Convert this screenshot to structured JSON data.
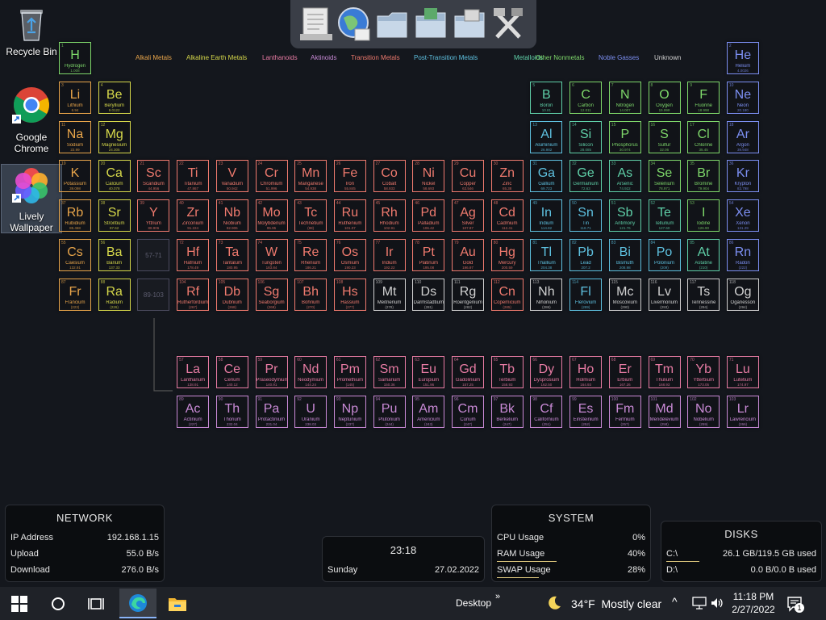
{
  "desktop": {
    "icons": [
      {
        "label1": "Recycle Bin",
        "label2": ""
      },
      {
        "label1": "Google",
        "label2": "Chrome"
      },
      {
        "label1": "Lively",
        "label2": "Wallpaper"
      }
    ]
  },
  "legend": [
    {
      "label": "Alkali Metals",
      "color": "#e8a54a"
    },
    {
      "label": "Alkaline Earth Metals",
      "color": "#d6d84a"
    },
    {
      "label": "Lanthanoids",
      "color": "#e77ba3"
    },
    {
      "label": "Aktinoids",
      "color": "#c98ad6"
    },
    {
      "label": "Transition Metals",
      "color": "#ef7a6e"
    },
    {
      "label": "Post-Transition Metals",
      "color": "#5ec1e0"
    },
    {
      "label": "Metalloids",
      "color": "#5fd0a8"
    },
    {
      "label": "Other Nonmetals",
      "color": "#7ed86a"
    },
    {
      "label": "Noble Gasses",
      "color": "#7c8ff2"
    },
    {
      "label": "Unknown",
      "color": "#d0d0d0"
    }
  ],
  "placeholders": [
    "57-71",
    "89-103"
  ],
  "elements": [
    [
      "H",
      "Hydrogen",
      "1.008",
      1,
      1,
      1,
      "nonmetal"
    ],
    [
      "He",
      "Helium",
      "4.0026",
      2,
      1,
      18,
      "noble"
    ],
    [
      "Li",
      "Lithium",
      "6.94",
      3,
      2,
      1,
      "alkali"
    ],
    [
      "Be",
      "Beryllium",
      "9.0122",
      4,
      2,
      2,
      "alkaline"
    ],
    [
      "B",
      "Boron",
      "10.81",
      5,
      2,
      13,
      "metalloid"
    ],
    [
      "C",
      "Carbon",
      "12.011",
      6,
      2,
      14,
      "nonmetal"
    ],
    [
      "N",
      "Nitrogen",
      "14.007",
      7,
      2,
      15,
      "nonmetal"
    ],
    [
      "O",
      "Oxygen",
      "15.999",
      8,
      2,
      16,
      "nonmetal"
    ],
    [
      "F",
      "Fluorine",
      "18.998",
      9,
      2,
      17,
      "nonmetal"
    ],
    [
      "Ne",
      "Neon",
      "20.180",
      10,
      2,
      18,
      "noble"
    ],
    [
      "Na",
      "Sodium",
      "22.99",
      11,
      3,
      1,
      "alkali"
    ],
    [
      "Mg",
      "Magnesium",
      "24.305",
      12,
      3,
      2,
      "alkaline"
    ],
    [
      "Al",
      "Aluminium",
      "26.982",
      13,
      3,
      13,
      "post"
    ],
    [
      "Si",
      "Silicon",
      "28.085",
      14,
      3,
      14,
      "metalloid"
    ],
    [
      "P",
      "Phosphorus",
      "30.974",
      15,
      3,
      15,
      "nonmetal"
    ],
    [
      "S",
      "Sulfur",
      "32.06",
      16,
      3,
      16,
      "nonmetal"
    ],
    [
      "Cl",
      "Chlorine",
      "35.45",
      17,
      3,
      17,
      "nonmetal"
    ],
    [
      "Ar",
      "Argon",
      "39.948",
      18,
      3,
      18,
      "noble"
    ],
    [
      "K",
      "Potassium",
      "39.098",
      19,
      4,
      1,
      "alkali"
    ],
    [
      "Ca",
      "Calcium",
      "40.078",
      20,
      4,
      2,
      "alkaline"
    ],
    [
      "Sc",
      "Scandium",
      "44.956",
      21,
      4,
      3,
      "transition"
    ],
    [
      "Ti",
      "Titanium",
      "47.867",
      22,
      4,
      4,
      "transition"
    ],
    [
      "V",
      "Vanadium",
      "50.942",
      23,
      4,
      5,
      "transition"
    ],
    [
      "Cr",
      "Chromium",
      "51.996",
      24,
      4,
      6,
      "transition"
    ],
    [
      "Mn",
      "Manganese",
      "54.938",
      25,
      4,
      7,
      "transition"
    ],
    [
      "Fe",
      "Iron",
      "55.845",
      26,
      4,
      8,
      "transition"
    ],
    [
      "Co",
      "Cobalt",
      "58.933",
      27,
      4,
      9,
      "transition"
    ],
    [
      "Ni",
      "Nickel",
      "58.693",
      28,
      4,
      10,
      "transition"
    ],
    [
      "Cu",
      "Copper",
      "63.546",
      29,
      4,
      11,
      "transition"
    ],
    [
      "Zn",
      "Zinc",
      "65.38",
      30,
      4,
      12,
      "transition"
    ],
    [
      "Ga",
      "Gallium",
      "69.723",
      31,
      4,
      13,
      "post"
    ],
    [
      "Ge",
      "Germanium",
      "72.63",
      32,
      4,
      14,
      "metalloid"
    ],
    [
      "As",
      "Arsenic",
      "74.922",
      33,
      4,
      15,
      "metalloid"
    ],
    [
      "Se",
      "Selenium",
      "78.971",
      34,
      4,
      16,
      "nonmetal"
    ],
    [
      "Br",
      "Bromine",
      "79.904",
      35,
      4,
      17,
      "nonmetal"
    ],
    [
      "Kr",
      "Krypton",
      "83.798",
      36,
      4,
      18,
      "noble"
    ],
    [
      "Rb",
      "Rubidium",
      "85.468",
      37,
      5,
      1,
      "alkali"
    ],
    [
      "Sr",
      "Strontium",
      "87.62",
      38,
      5,
      2,
      "alkaline"
    ],
    [
      "Y",
      "Yttrium",
      "88.906",
      39,
      5,
      3,
      "transition"
    ],
    [
      "Zr",
      "Zirconium",
      "91.224",
      40,
      5,
      4,
      "transition"
    ],
    [
      "Nb",
      "Niobium",
      "92.906",
      41,
      5,
      5,
      "transition"
    ],
    [
      "Mo",
      "Molybdenum",
      "95.95",
      42,
      5,
      6,
      "transition"
    ],
    [
      "Tc",
      "Technetium",
      "(98)",
      43,
      5,
      7,
      "transition"
    ],
    [
      "Ru",
      "Ruthenium",
      "101.07",
      44,
      5,
      8,
      "transition"
    ],
    [
      "Rh",
      "Rhodium",
      "102.91",
      45,
      5,
      9,
      "transition"
    ],
    [
      "Pd",
      "Palladium",
      "106.42",
      46,
      5,
      10,
      "transition"
    ],
    [
      "Ag",
      "Silver",
      "107.87",
      47,
      5,
      11,
      "transition"
    ],
    [
      "Cd",
      "Cadmium",
      "112.41",
      48,
      5,
      12,
      "transition"
    ],
    [
      "In",
      "Indium",
      "114.82",
      49,
      5,
      13,
      "post"
    ],
    [
      "Sn",
      "Tin",
      "118.71",
      50,
      5,
      14,
      "post"
    ],
    [
      "Sb",
      "Antimony",
      "121.76",
      51,
      5,
      15,
      "metalloid"
    ],
    [
      "Te",
      "Tellurium",
      "127.60",
      52,
      5,
      16,
      "metalloid"
    ],
    [
      "I",
      "Iodine",
      "126.90",
      53,
      5,
      17,
      "nonmetal"
    ],
    [
      "Xe",
      "Xenon",
      "131.29",
      54,
      5,
      18,
      "noble"
    ],
    [
      "Cs",
      "Caesium",
      "132.91",
      55,
      6,
      1,
      "alkali"
    ],
    [
      "Ba",
      "Barium",
      "137.33",
      56,
      6,
      2,
      "alkaline"
    ],
    [
      "Hf",
      "Hafnium",
      "178.49",
      72,
      6,
      4,
      "transition"
    ],
    [
      "Ta",
      "Tantalum",
      "180.95",
      73,
      6,
      5,
      "transition"
    ],
    [
      "W",
      "Tungsten",
      "183.84",
      74,
      6,
      6,
      "transition"
    ],
    [
      "Re",
      "Rhenium",
      "186.21",
      75,
      6,
      7,
      "transition"
    ],
    [
      "Os",
      "Osmium",
      "190.23",
      76,
      6,
      8,
      "transition"
    ],
    [
      "Ir",
      "Iridium",
      "192.22",
      77,
      6,
      9,
      "transition"
    ],
    [
      "Pt",
      "Platinum",
      "195.08",
      78,
      6,
      10,
      "transition"
    ],
    [
      "Au",
      "Gold",
      "196.97",
      79,
      6,
      11,
      "transition"
    ],
    [
      "Hg",
      "Mercury",
      "200.59",
      80,
      6,
      12,
      "transition"
    ],
    [
      "Tl",
      "Thallium",
      "204.38",
      81,
      6,
      13,
      "post"
    ],
    [
      "Pb",
      "Lead",
      "207.2",
      82,
      6,
      14,
      "post"
    ],
    [
      "Bi",
      "Bismuth",
      "208.98",
      83,
      6,
      15,
      "post"
    ],
    [
      "Po",
      "Polonium",
      "(209)",
      84,
      6,
      16,
      "post"
    ],
    [
      "At",
      "Astatine",
      "(210)",
      85,
      6,
      17,
      "metalloid"
    ],
    [
      "Rn",
      "Radon",
      "(222)",
      86,
      6,
      18,
      "noble"
    ],
    [
      "Fr",
      "Francium",
      "(223)",
      87,
      7,
      1,
      "alkali"
    ],
    [
      "Ra",
      "Radium",
      "(226)",
      88,
      7,
      2,
      "alkaline"
    ],
    [
      "Rf",
      "Rutherfordium",
      "(267)",
      104,
      7,
      4,
      "transition"
    ],
    [
      "Db",
      "Dubnium",
      "(268)",
      105,
      7,
      5,
      "transition"
    ],
    [
      "Sg",
      "Seaborgium",
      "(269)",
      106,
      7,
      6,
      "transition"
    ],
    [
      "Bh",
      "Bohrium",
      "(270)",
      107,
      7,
      7,
      "transition"
    ],
    [
      "Hs",
      "Hassium",
      "(277)",
      108,
      7,
      8,
      "transition"
    ],
    [
      "Mt",
      "Meitnerium",
      "(278)",
      109,
      7,
      9,
      "unknown"
    ],
    [
      "Ds",
      "Darmstadtium",
      "(281)",
      110,
      7,
      10,
      "unknown"
    ],
    [
      "Rg",
      "Roentgenium",
      "(282)",
      111,
      7,
      11,
      "unknown"
    ],
    [
      "Cn",
      "Copernicium",
      "(285)",
      112,
      7,
      12,
      "transition"
    ],
    [
      "Nh",
      "Nihonium",
      "(286)",
      113,
      7,
      13,
      "unknown"
    ],
    [
      "Fl",
      "Flerovium",
      "(289)",
      114,
      7,
      14,
      "post"
    ],
    [
      "Mc",
      "Moscovium",
      "(290)",
      115,
      7,
      15,
      "unknown"
    ],
    [
      "Lv",
      "Livermorium",
      "(293)",
      116,
      7,
      16,
      "unknown"
    ],
    [
      "Ts",
      "Tennessine",
      "(294)",
      117,
      7,
      17,
      "unknown"
    ],
    [
      "Og",
      "Oganesson",
      "(294)",
      118,
      7,
      18,
      "unknown"
    ],
    [
      "La",
      "Lanthanum",
      "138.91",
      57,
      9,
      4,
      "lanthanoid"
    ],
    [
      "Ce",
      "Cerium",
      "140.12",
      58,
      9,
      5,
      "lanthanoid"
    ],
    [
      "Pr",
      "Praseodymium",
      "140.91",
      59,
      9,
      6,
      "lanthanoid"
    ],
    [
      "Nd",
      "Neodymium",
      "144.24",
      60,
      9,
      7,
      "lanthanoid"
    ],
    [
      "Pm",
      "Promethium",
      "(145)",
      61,
      9,
      8,
      "lanthanoid"
    ],
    [
      "Sm",
      "Samarium",
      "150.36",
      62,
      9,
      9,
      "lanthanoid"
    ],
    [
      "Eu",
      "Europium",
      "151.96",
      63,
      9,
      10,
      "lanthanoid"
    ],
    [
      "Gd",
      "Gadolinium",
      "157.25",
      64,
      9,
      11,
      "lanthanoid"
    ],
    [
      "Tb",
      "Terbium",
      "158.93",
      65,
      9,
      12,
      "lanthanoid"
    ],
    [
      "Dy",
      "Dysprosium",
      "162.50",
      66,
      9,
      13,
      "lanthanoid"
    ],
    [
      "Ho",
      "Holmium",
      "164.93",
      67,
      9,
      14,
      "lanthanoid"
    ],
    [
      "Er",
      "Erbium",
      "167.26",
      68,
      9,
      15,
      "lanthanoid"
    ],
    [
      "Tm",
      "Thulium",
      "168.93",
      69,
      9,
      16,
      "lanthanoid"
    ],
    [
      "Yb",
      "Ytterbium",
      "173.05",
      70,
      9,
      17,
      "lanthanoid"
    ],
    [
      "Lu",
      "Lutetium",
      "174.97",
      71,
      9,
      18,
      "lanthanoid"
    ],
    [
      "Ac",
      "Actinium",
      "(227)",
      89,
      10,
      4,
      "aktinoid"
    ],
    [
      "Th",
      "Thorium",
      "232.04",
      90,
      10,
      5,
      "aktinoid"
    ],
    [
      "Pa",
      "Protactinium",
      "231.04",
      91,
      10,
      6,
      "aktinoid"
    ],
    [
      "U",
      "Uranium",
      "238.03",
      92,
      10,
      7,
      "aktinoid"
    ],
    [
      "Np",
      "Neptunium",
      "(237)",
      93,
      10,
      8,
      "aktinoid"
    ],
    [
      "Pu",
      "Plutonium",
      "(244)",
      94,
      10,
      9,
      "aktinoid"
    ],
    [
      "Am",
      "Americium",
      "(243)",
      95,
      10,
      10,
      "aktinoid"
    ],
    [
      "Cm",
      "Curium",
      "(247)",
      96,
      10,
      11,
      "aktinoid"
    ],
    [
      "Bk",
      "Berkelium",
      "(247)",
      97,
      10,
      12,
      "aktinoid"
    ],
    [
      "Cf",
      "Californium",
      "(251)",
      98,
      10,
      13,
      "aktinoid"
    ],
    [
      "Es",
      "Einsteinium",
      "(252)",
      99,
      10,
      14,
      "aktinoid"
    ],
    [
      "Fm",
      "Fermium",
      "(257)",
      100,
      10,
      15,
      "aktinoid"
    ],
    [
      "Md",
      "Mendelevium",
      "(258)",
      101,
      10,
      16,
      "aktinoid"
    ],
    [
      "No",
      "Nobelium",
      "(259)",
      102,
      10,
      17,
      "aktinoid"
    ],
    [
      "Lr",
      "Lawrencium",
      "(266)",
      103,
      10,
      18,
      "aktinoid"
    ]
  ],
  "category_colors": {
    "alkali": "#e8a54a",
    "alkaline": "#d6d84a",
    "lanthanoid": "#e77ba3",
    "aktinoid": "#c98ad6",
    "transition": "#ef7a6e",
    "post": "#5ec1e0",
    "metalloid": "#5fd0a8",
    "nonmetal": "#7ed86a",
    "noble": "#7c8ff2",
    "unknown": "#d0d0d0"
  },
  "network": {
    "title": "NETWORK",
    "rows": [
      {
        "k": "IP Address",
        "v": "192.168.1.15"
      },
      {
        "k": "Upload",
        "v": "55.0 B/s"
      },
      {
        "k": "Download",
        "v": "276.0 B/s"
      }
    ]
  },
  "clock_widget": {
    "time": "23:18",
    "day": "Sunday",
    "date": "27.02.2022"
  },
  "system": {
    "title": "SYSTEM",
    "rows": [
      {
        "k": "CPU Usage",
        "v": "0%",
        "fill": 0.0
      },
      {
        "k": "RAM Usage",
        "v": "40%",
        "fill": 0.4
      },
      {
        "k": "SWAP Usage",
        "v": "28%",
        "fill": 0.28
      }
    ]
  },
  "disks": {
    "title": "DISKS",
    "rows": [
      {
        "k": "C:\\",
        "v": "26.1 GB/119.5 GB used",
        "fill": 0.22
      },
      {
        "k": "D:\\",
        "v": "0.0 B/0.0 B used",
        "fill": 0.0
      }
    ]
  },
  "taskbar": {
    "desktop_label": "Desktop",
    "weather": "34°F  Mostly clear",
    "time": "11:18 PM",
    "date": "2/27/2022",
    "notification_count": "1"
  }
}
